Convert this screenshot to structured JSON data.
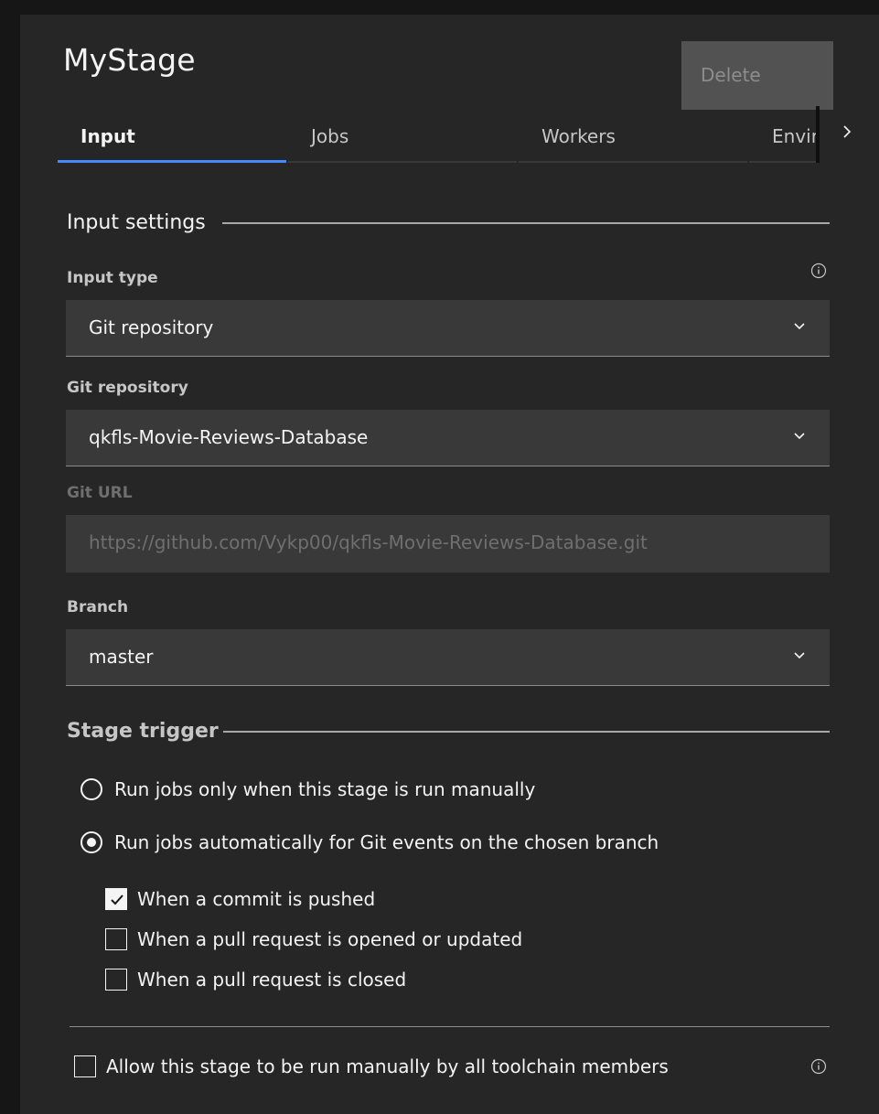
{
  "header": {
    "title": "MyStage",
    "delete_label": "Delete"
  },
  "tabs": [
    {
      "label": "Input",
      "active": true
    },
    {
      "label": "Jobs",
      "active": false
    },
    {
      "label": "Workers",
      "active": false
    },
    {
      "label": "Envir",
      "active": false
    }
  ],
  "input_settings": {
    "heading": "Input settings",
    "input_type": {
      "label": "Input type",
      "value": "Git repository"
    },
    "git_repository": {
      "label": "Git repository",
      "value": "qkfls-Movie-Reviews-Database"
    },
    "git_url": {
      "label": "Git URL",
      "value": "https://github.com/Vykp00/qkfls-Movie-Reviews-Database.git",
      "disabled": true
    },
    "branch": {
      "label": "Branch",
      "value": "master"
    }
  },
  "stage_trigger": {
    "heading": "Stage trigger",
    "options": [
      {
        "label": "Run jobs only when this stage is run manually",
        "selected": false
      },
      {
        "label": "Run jobs automatically for Git events on the chosen branch",
        "selected": true
      }
    ],
    "events": [
      {
        "label": "When a commit is pushed",
        "checked": true
      },
      {
        "label": "When a pull request is opened or updated",
        "checked": false
      },
      {
        "label": "When a pull request is closed",
        "checked": false
      }
    ],
    "allow_manual": {
      "label": "Allow this stage to be run manually by all toolchain members",
      "checked": false
    }
  },
  "icons": {
    "info": "info-icon",
    "chevron": "chevron-down-icon",
    "next": "chevron-right-icon",
    "check": "checkmark-icon"
  },
  "colors": {
    "background": "#262626",
    "field": "#393939",
    "accent": "#4589ff",
    "text": "#f4f4f4"
  }
}
